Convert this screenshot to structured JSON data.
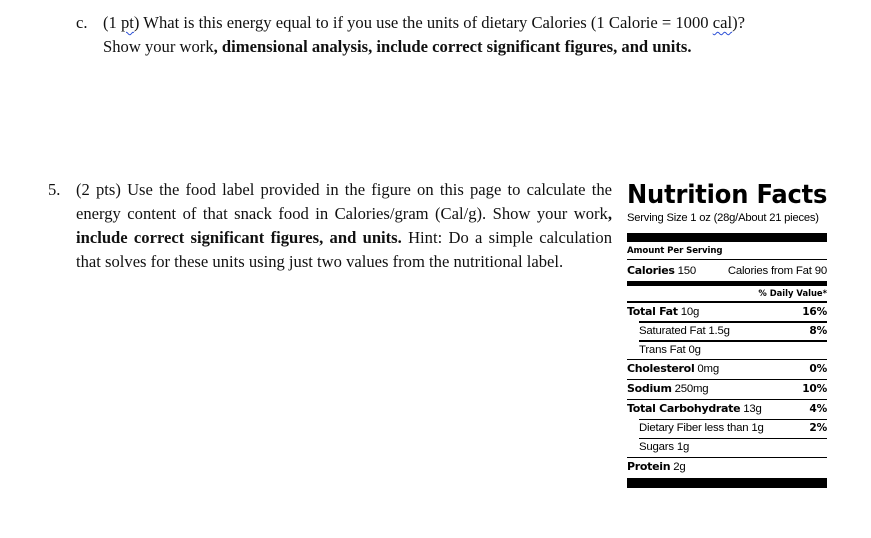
{
  "question_c": {
    "marker": "c.",
    "line1_pre": "(1 ",
    "line1_pt": "pt",
    "line1_mid": ") What is this energy equal to if you use the units of dietary Calories (1 Calorie = 1000 ",
    "line1_cal": "cal",
    "line1_post": ")?",
    "line2_plain": "Show your work",
    "line2_bold": ", dimensional analysis, include correct significant figures, and units."
  },
  "question_5": {
    "marker": "5.",
    "text_a": "(2 pts) Use the food label provided in the figure on this page to calculate the energy content of that snack food in Calories/gram (Cal/g). Show your work",
    "text_bold": ", include correct significant figures, and units.",
    "text_b": " Hint: Do a simple calculation that solves for these units using just two values from the nutritional label."
  },
  "nutrition_label": {
    "title": "Nutrition Facts",
    "serving_size": "Serving Size 1 oz (28g/About 21 pieces)",
    "amount_per_serving": "Amount Per Serving",
    "calories_label": "Calories",
    "calories_value": "150",
    "calories_from_fat": "Calories from Fat 90",
    "daily_value_header": "% Daily Value*",
    "rows": [
      {
        "label": "Total Fat",
        "value": "10g",
        "pct": "16%",
        "bold": true,
        "indent": false
      },
      {
        "label": "Saturated Fat",
        "value": "1.5g",
        "pct": "8%",
        "bold": false,
        "indent": true
      },
      {
        "label": "Trans Fat",
        "value": "0g",
        "pct": "",
        "bold": false,
        "indent": true
      },
      {
        "label": "Cholesterol",
        "value": "0mg",
        "pct": "0%",
        "bold": true,
        "indent": false
      },
      {
        "label": "Sodium",
        "value": "250mg",
        "pct": "10%",
        "bold": true,
        "indent": false
      },
      {
        "label": "Total Carbohydrate",
        "value": "13g",
        "pct": "4%",
        "bold": true,
        "indent": false
      },
      {
        "label": "Dietary Fiber less than",
        "value": "1g",
        "pct": "2%",
        "bold": false,
        "indent": true
      },
      {
        "label": "Sugars",
        "value": "1g",
        "pct": "",
        "bold": false,
        "indent": true
      },
      {
        "label": "Protein",
        "value": "2g",
        "pct": "",
        "bold": true,
        "indent": false
      }
    ]
  }
}
